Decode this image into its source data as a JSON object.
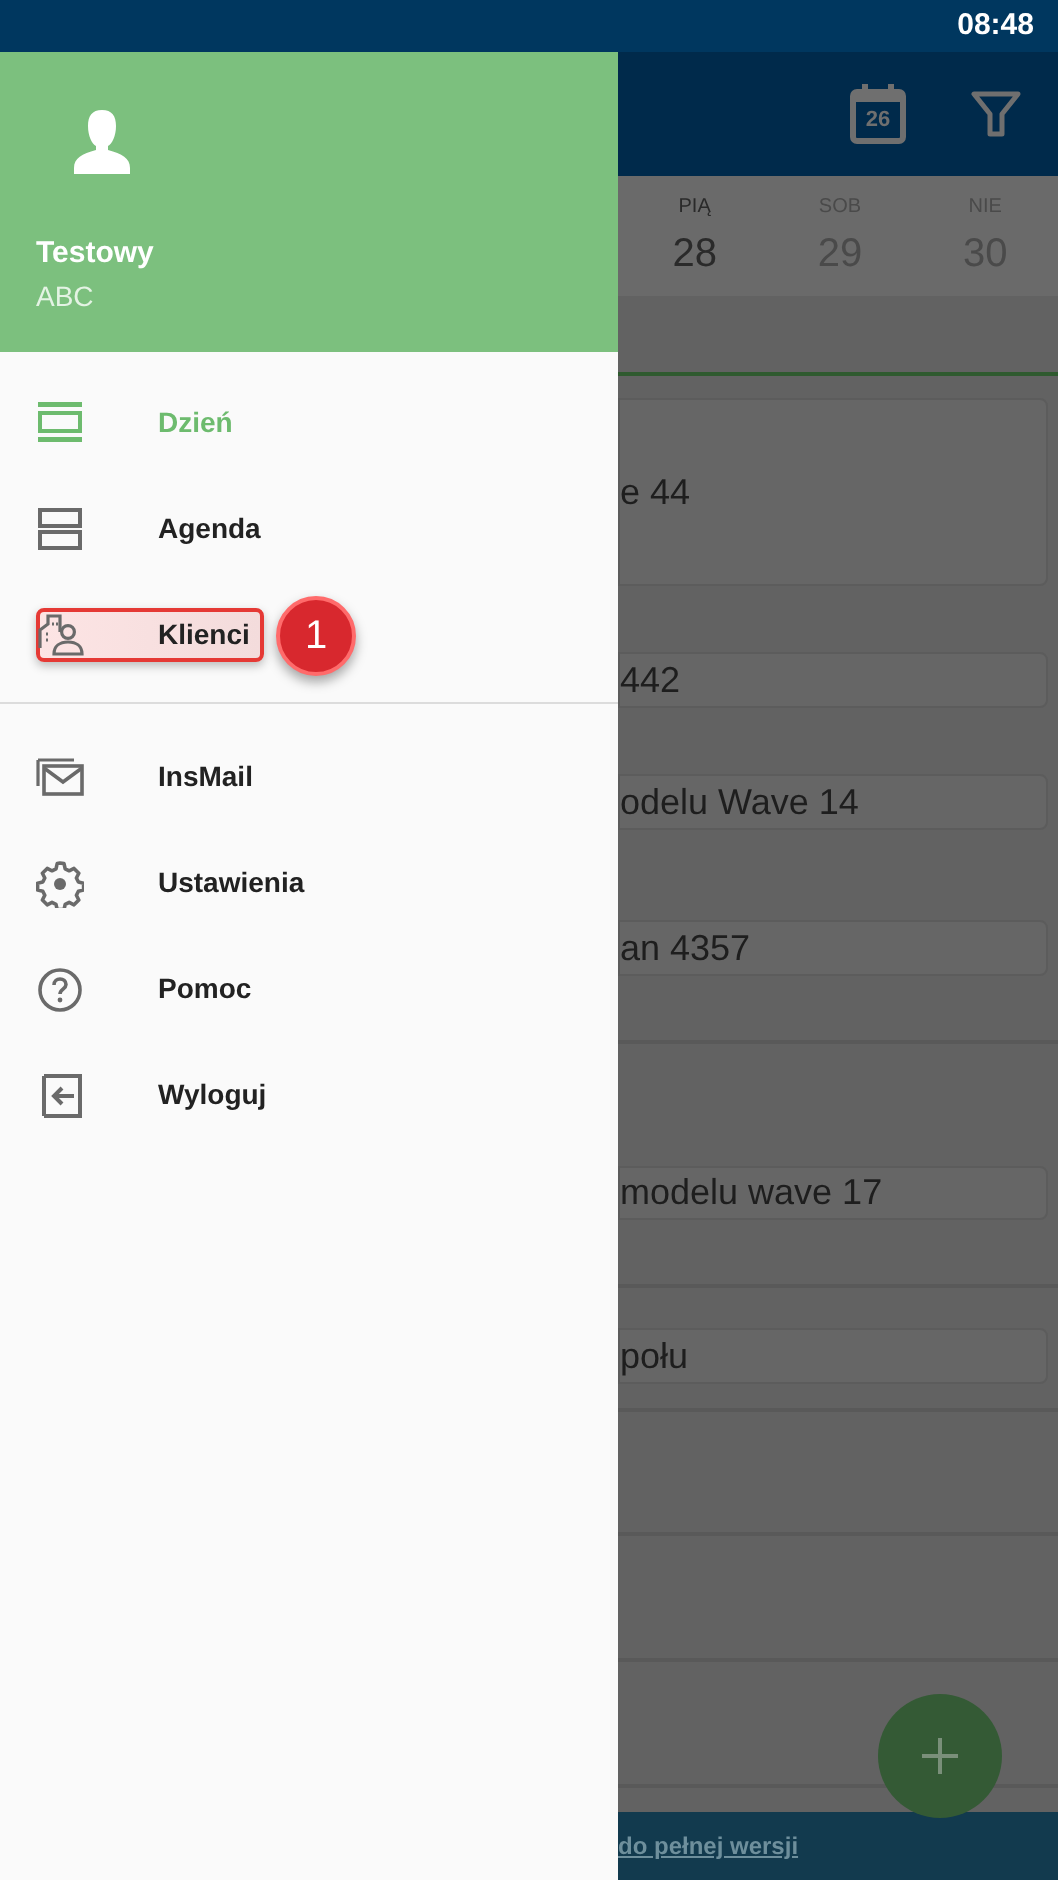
{
  "status_bar": {
    "time": "08:48"
  },
  "drawer": {
    "user": {
      "name": "Testowy",
      "subtitle": "ABC"
    },
    "groups": [
      [
        {
          "label": "Dzień",
          "kind": "day",
          "selected": true
        },
        {
          "label": "Agenda",
          "kind": "agenda",
          "selected": false
        },
        {
          "label": "Klienci",
          "kind": "clients",
          "selected": false,
          "callout": "1"
        }
      ],
      [
        {
          "label": "InsMail",
          "kind": "mail",
          "selected": false
        },
        {
          "label": "Ustawienia",
          "kind": "settings",
          "selected": false
        },
        {
          "label": "Pomoc",
          "kind": "help",
          "selected": false
        },
        {
          "label": "Wyloguj",
          "kind": "logout",
          "selected": false
        }
      ]
    ]
  },
  "app_bar": {
    "calendar_day": "26"
  },
  "days": [
    {
      "weekday": "PIĄ",
      "date": "28",
      "selected": true
    },
    {
      "weekday": "SOB",
      "date": "29",
      "selected": false
    },
    {
      "weekday": "NIE",
      "date": "30",
      "selected": false
    }
  ],
  "events": [
    {
      "text": "e 44"
    },
    {
      "text": "442"
    },
    {
      "text": "odelu Wave 14"
    },
    {
      "text": "an 4357"
    },
    {
      "text": "modelu wave 17"
    },
    {
      "text": "połu"
    }
  ],
  "footer": {
    "link": "do pełnej wersji"
  }
}
